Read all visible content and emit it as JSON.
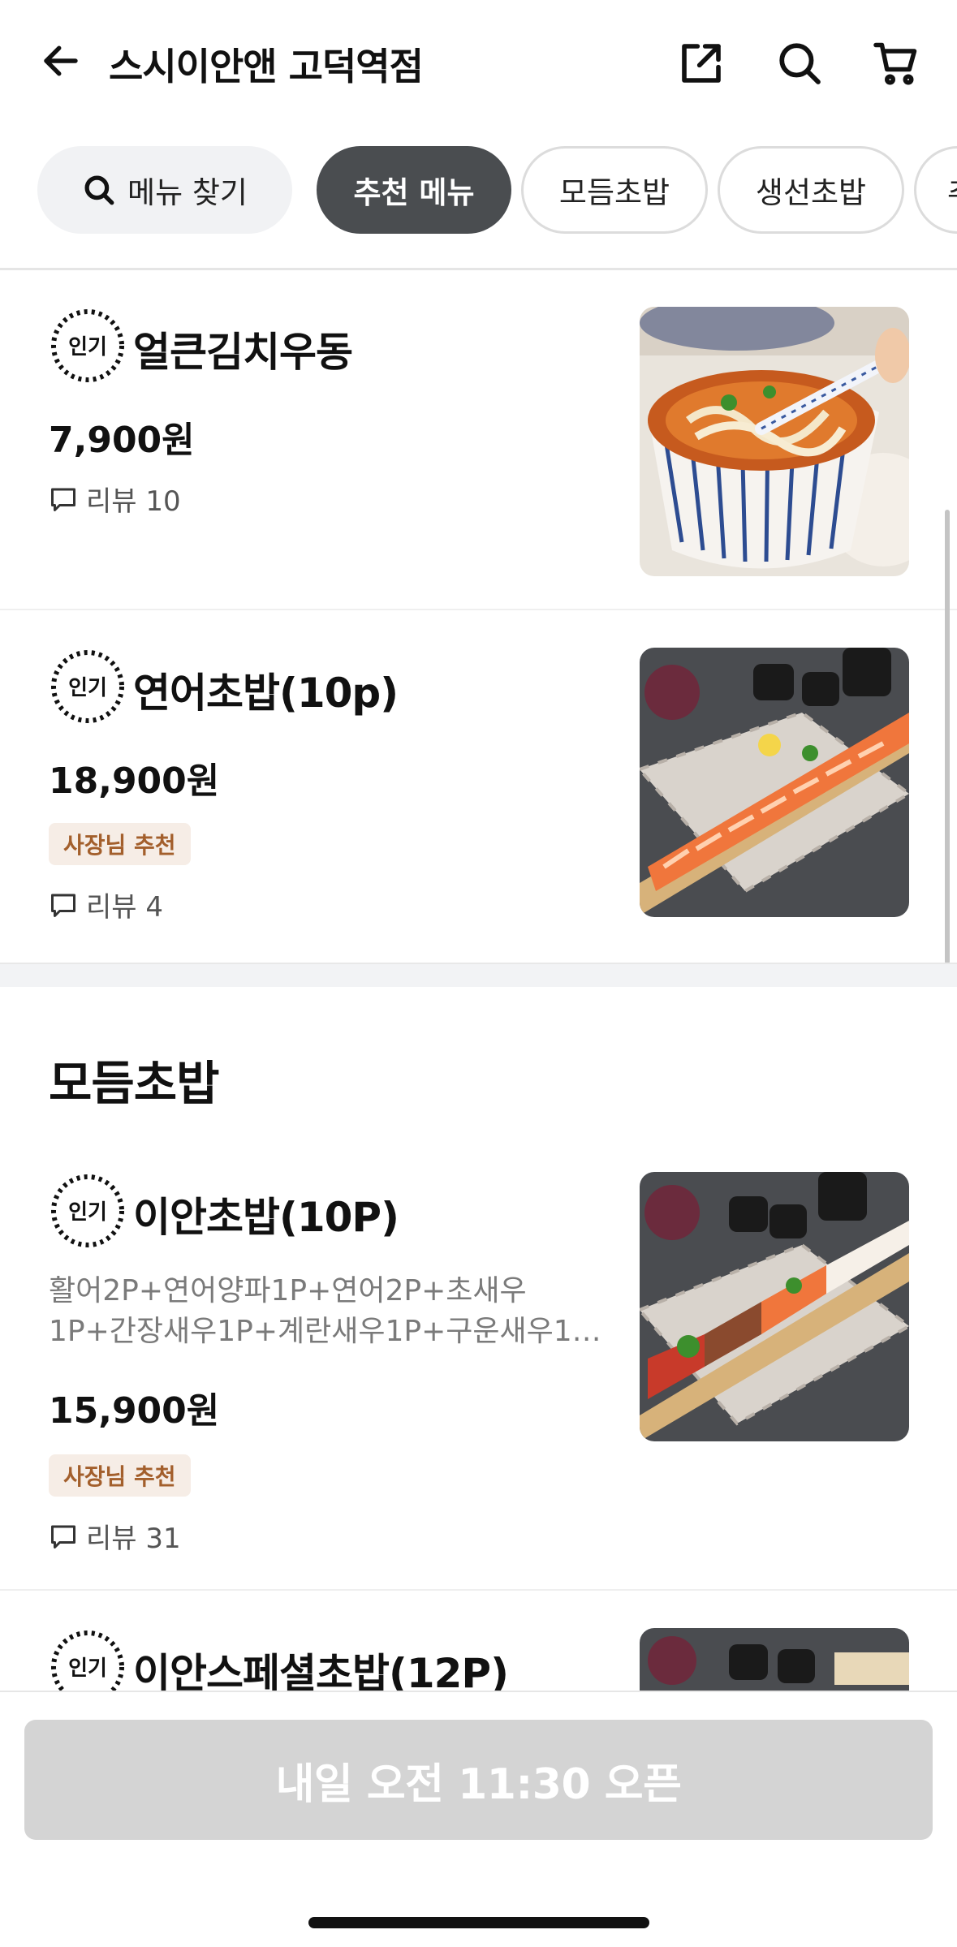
{
  "header": {
    "title": "스시이안앤 고덕역점",
    "back_icon": "arrow-left-icon",
    "share_icon": "share-icon",
    "search_icon": "search-icon",
    "cart_icon": "cart-icon"
  },
  "chips": {
    "search_label": "메뉴 찾기",
    "items": [
      "추천 메뉴",
      "모듬초밥",
      "생선초밥",
      "추"
    ]
  },
  "items": [
    {
      "badge": "인기",
      "name": "얼큰김치우동",
      "price": "7,900원",
      "review": "리뷰 10"
    },
    {
      "badge": "인기",
      "name": "연어초밥(10p)",
      "price": "18,900원",
      "rec": "사장님 추천",
      "review": "리뷰 4"
    },
    {
      "badge": "인기",
      "name": "이안초밥(10P)",
      "desc": "활어2P+연어양파1P+연어2P+초새우 1P+간장새우1P+계란새우1P+구운새우1…",
      "price": "15,900원",
      "rec": "사장님 추천",
      "review": "리뷰 31"
    },
    {
      "badge": "인기",
      "name": "이안스페셜초밥(12P)"
    }
  ],
  "section": {
    "title": "모듬초밥"
  },
  "bottom": {
    "cta": "내일 오전 11:30 오픈"
  },
  "colors": {
    "active_chip": "#4a4d50",
    "rec_bg": "#f6ede6",
    "rec_text": "#a35f2c",
    "cta_disabled": "#d4d4d4"
  }
}
